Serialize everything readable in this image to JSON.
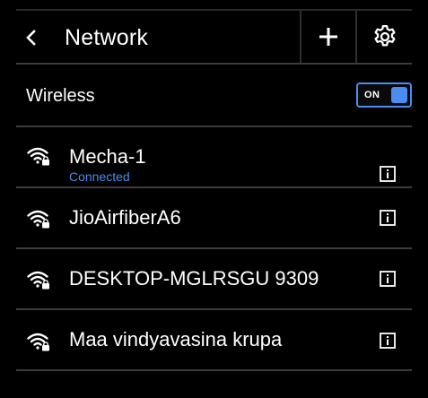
{
  "header": {
    "title": "Network"
  },
  "wireless": {
    "label": "Wireless",
    "toggle_state": "ON",
    "enabled": true
  },
  "networks": [
    {
      "name": "Mecha-1",
      "status": "Connected",
      "icon": "wifi-lock-icon"
    },
    {
      "name": "JioAirfiberA6",
      "status": "",
      "icon": "wifi-lock-icon"
    },
    {
      "name": "DESKTOP-MGLRSGU 9309",
      "status": "",
      "icon": "wifi-lock-icon"
    },
    {
      "name": "Maa vindyavasina krupa",
      "status": "",
      "icon": "wifi-lock-icon"
    }
  ],
  "colors": {
    "background": "#000000",
    "accent": "#4a8cf0",
    "divider": "#3c3c3c",
    "text": "#ffffff"
  }
}
